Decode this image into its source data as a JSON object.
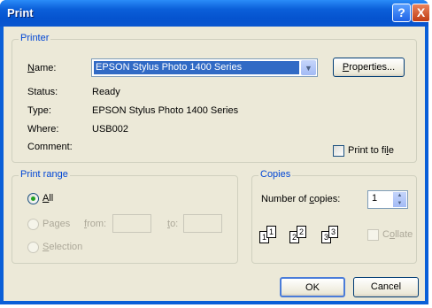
{
  "window": {
    "title": "Print",
    "help_glyph": "?",
    "close_glyph": "X"
  },
  "printer": {
    "legend": "Printer",
    "name_label_u": "N",
    "name_label_rest": "ame:",
    "name_value": "EPSON Stylus Photo 1400 Series",
    "properties_u": "P",
    "properties_rest": "roperties...",
    "status_label": "Status:",
    "status_value": "Ready",
    "type_label": "Type:",
    "type_value": "EPSON Stylus Photo 1400 Series",
    "where_label": "Where:",
    "where_value": "USB002",
    "comment_label": "Comment:",
    "print_to_file_pre": "Print to fi",
    "print_to_file_u": "l",
    "print_to_file_post": "e",
    "print_to_file_checked": false
  },
  "print_range": {
    "legend": "Print range",
    "all_u": "A",
    "all_rest": "ll",
    "pages_pre": "Pa",
    "pages_u": "g",
    "pages_post": "es",
    "from_u": "f",
    "from_rest": "rom:",
    "to_u": "t",
    "to_rest": "o:",
    "selection_u": "S",
    "selection_rest": "election",
    "selected": "All"
  },
  "copies": {
    "legend": "Copies",
    "number_pre": "Number of ",
    "number_u": "c",
    "number_post": "opies:",
    "number_value": "1",
    "page_labels": [
      "1",
      "1",
      "2",
      "2",
      "3",
      "3"
    ],
    "collate_pre": "C",
    "collate_u": "o",
    "collate_post": "llate",
    "collate_checked": false
  },
  "buttons": {
    "ok": "OK",
    "cancel": "Cancel"
  }
}
